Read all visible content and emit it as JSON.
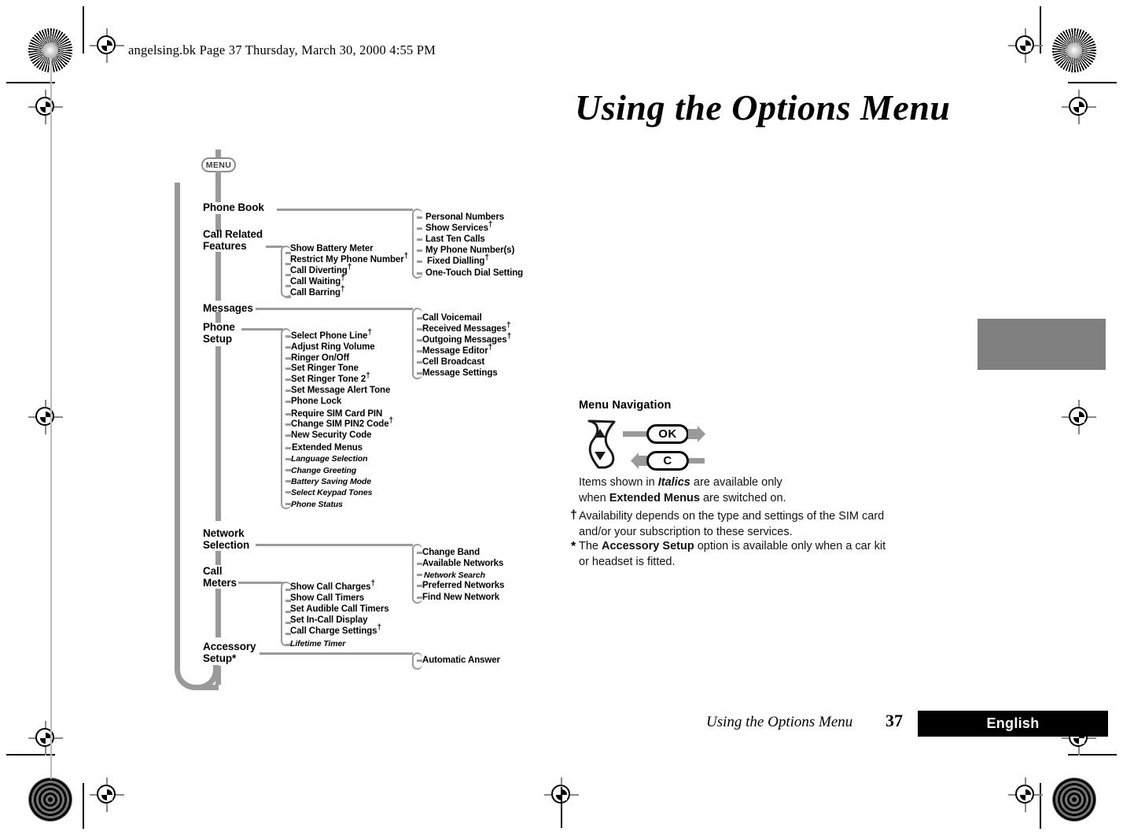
{
  "header": {
    "file_line": "angelsing.bk  Page 37  Thursday, March 30, 2000  4:55 PM"
  },
  "page": {
    "title": "Using the Options Menu"
  },
  "footer": {
    "title": "Using the Options Menu",
    "page_number": "37",
    "language": "English"
  },
  "menu_tree": {
    "root_button": "MENU",
    "top_level": [
      {
        "label": "Phone Book"
      },
      {
        "label": "Call Related\nFeatures"
      },
      {
        "label": "Messages"
      },
      {
        "label": "Phone\nSetup"
      },
      {
        "label": "Network\nSelection"
      },
      {
        "label": "Call\nMeters"
      },
      {
        "label": "Accessory\nSetup*"
      }
    ],
    "submenus": {
      "phone_book": [
        {
          "label": "Personal Numbers",
          "dagger": false,
          "italic": false
        },
        {
          "label": "Show Services",
          "dagger": true,
          "italic": false
        },
        {
          "label": "Last Ten Calls",
          "dagger": false,
          "italic": false
        },
        {
          "label": "My Phone Number(s)",
          "dagger": false,
          "italic": false
        },
        {
          "label": "Fixed Dialling",
          "dagger": true,
          "italic": false
        },
        {
          "label": "One-Touch Dial Setting",
          "dagger": false,
          "italic": false
        }
      ],
      "call_related_features": [
        {
          "label": "Show Battery Meter",
          "dagger": false,
          "italic": false
        },
        {
          "label": "Restrict My Phone Number",
          "dagger": true,
          "italic": false
        },
        {
          "label": "Call Diverting",
          "dagger": true,
          "italic": false
        },
        {
          "label": "Call Waiting",
          "dagger": true,
          "italic": false
        },
        {
          "label": "Call Barring",
          "dagger": true,
          "italic": false
        }
      ],
      "messages": [
        {
          "label": "Call Voicemail",
          "dagger": false,
          "italic": false
        },
        {
          "label": "Received Messages",
          "dagger": true,
          "italic": false
        },
        {
          "label": "Outgoing Messages",
          "dagger": true,
          "italic": false
        },
        {
          "label": "Message Editor",
          "dagger": true,
          "italic": false
        },
        {
          "label": "Cell Broadcast",
          "dagger": false,
          "italic": false
        },
        {
          "label": "Message Settings",
          "dagger": false,
          "italic": false
        }
      ],
      "phone_setup": [
        {
          "label": "Select Phone Line",
          "dagger": true,
          "italic": false
        },
        {
          "label": "Adjust Ring Volume",
          "dagger": false,
          "italic": false
        },
        {
          "label": "Ringer On/Off",
          "dagger": false,
          "italic": false
        },
        {
          "label": "Set Ringer Tone",
          "dagger": false,
          "italic": false
        },
        {
          "label": "Set Ringer Tone 2",
          "dagger": true,
          "italic": false
        },
        {
          "label": "Set Message Alert Tone",
          "dagger": false,
          "italic": false
        },
        {
          "label": "Phone Lock",
          "dagger": false,
          "italic": false
        },
        {
          "label": "Require SIM Card PIN",
          "dagger": false,
          "italic": false
        },
        {
          "label": "Change SIM PIN2 Code",
          "dagger": true,
          "italic": false
        },
        {
          "label": "New Security Code",
          "dagger": false,
          "italic": false
        },
        {
          "label": "Extended Menus",
          "dagger": false,
          "italic": false
        },
        {
          "label": "Language Selection",
          "dagger": false,
          "italic": true
        },
        {
          "label": "Change Greeting",
          "dagger": false,
          "italic": true
        },
        {
          "label": "Battery Saving Mode",
          "dagger": false,
          "italic": true
        },
        {
          "label": "Select Keypad Tones",
          "dagger": false,
          "italic": true
        },
        {
          "label": "Phone Status",
          "dagger": false,
          "italic": true
        }
      ],
      "network_selection": [
        {
          "label": "Change Band",
          "dagger": false,
          "italic": false
        },
        {
          "label": "Available Networks",
          "dagger": false,
          "italic": false
        },
        {
          "label": "Network Search",
          "dagger": false,
          "italic": true
        },
        {
          "label": "Preferred Networks",
          "dagger": false,
          "italic": false
        },
        {
          "label": "Find New Network",
          "dagger": false,
          "italic": false
        }
      ],
      "call_meters": [
        {
          "label": "Show Call Charges",
          "dagger": true,
          "italic": false
        },
        {
          "label": "Show Call Timers",
          "dagger": false,
          "italic": false
        },
        {
          "label": "Set Audible Call Timers",
          "dagger": false,
          "italic": false
        },
        {
          "label": "Set In-Call Display",
          "dagger": false,
          "italic": false
        },
        {
          "label": "Call Charge Settings",
          "dagger": true,
          "italic": false
        },
        {
          "label": "Lifetime Timer",
          "dagger": false,
          "italic": true
        }
      ],
      "accessory_setup": [
        {
          "label": "Automatic Answer",
          "dagger": false,
          "italic": false
        }
      ]
    }
  },
  "menu_navigation": {
    "title": "Menu Navigation",
    "ok_key": "OK",
    "clear_key": "C",
    "notes": [
      {
        "marker": "",
        "html": "Items shown in <i>Italics</i> are available only<br>when <b>Extended Menus</b> are switched on."
      },
      {
        "marker": "†",
        "html": "Availability depends on the type and settings of the SIM card<br>and/or your subscription to these services."
      },
      {
        "marker": "*",
        "html": "The <b>Accessory Setup</b> option is available only when a car kit<br>or headset is fitted."
      }
    ]
  },
  "colors": {
    "tree_gray": "#9a9a9a",
    "thumb_tab": "#808080",
    "footer_bar": "#000000"
  }
}
